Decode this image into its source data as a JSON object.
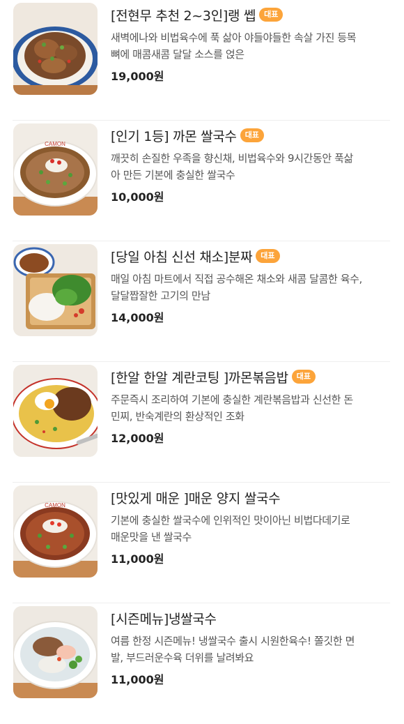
{
  "menu": {
    "items": [
      {
        "title": "[전현무 추천 2~3인]랭 쎕",
        "badge": "대표",
        "desc_line1": "새벽에나와 비법육수에 푹 삶아 야들야들한 속살 가진 등목",
        "desc_line2": "뼈에 매콤새콤 달달 소스를 얹은",
        "price": "19,000원",
        "image": "laeng-ssaep-photo"
      },
      {
        "title": "[인기 1등] 까몬 쌀국수",
        "badge": "대표",
        "desc_line1": "깨끗히 손질한 우족을 향신채, 비법육수와 9시간동안 푹삶",
        "desc_line2": "아 만든 기본에 충실한 쌀국수",
        "price": "10,000원",
        "image": "rice-noodle-soup-photo"
      },
      {
        "title": "[당일 아침 신선 채소]분짜",
        "badge": "대표",
        "desc_line1": "매일 아침 마트에서 직접 공수해온 채소와 새콤 달콤한 육수,",
        "desc_line2": "달달짭잘한 고기의 만남",
        "price": "14,000원",
        "image": "bun-cha-photo"
      },
      {
        "title": "[한알 한알 계란코팅 ]까몬볶음밥",
        "badge": "대표",
        "desc_line1": "주문즉시 조리하여 기본에 충실한 계란볶음밥과 신선한 돈",
        "desc_line2": "민찌, 반숙계란의 환상적인 조화",
        "price": "12,000원",
        "image": "fried-rice-photo"
      },
      {
        "title": "[맛있게 매운 ]매운 양지 쌀국수",
        "badge": "",
        "desc_line1": "기본에 충실한 쌀국수에 인위적인 맛이아닌 비법다데기로",
        "desc_line2": "매운맛을 낸 쌀국수",
        "price": "11,000원",
        "image": "spicy-rice-noodle-photo"
      },
      {
        "title": "[시즌메뉴]냉쌀국수",
        "badge": "",
        "desc_line1": "여름 한정 시즌메뉴! 냉쌀국수 출시 시원한육수! 쫄깃한 면",
        "desc_line2": "발, 부드러운수육 더위를 날려봐요",
        "price": "11,000원",
        "image": "cold-rice-noodle-photo"
      }
    ]
  },
  "colors": {
    "badge": "#fca43a",
    "title": "#222222",
    "desc": "#555555",
    "divider": "#eeeeee"
  }
}
